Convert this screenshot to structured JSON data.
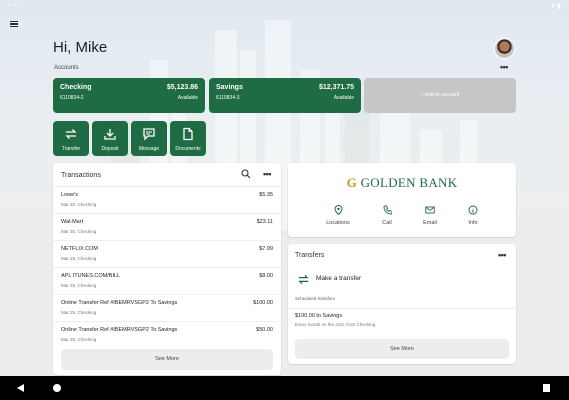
{
  "greeting": "Hi, Mike",
  "accounts_label": "Accounts",
  "accounts": [
    {
      "name": "Checking",
      "balance": "$5,123.86",
      "number": "6110834-2",
      "available": "Available"
    },
    {
      "name": "Savings",
      "balance": "$12,371.75",
      "number": "6110834-3",
      "available": "Available"
    }
  ],
  "add_account": "+ Add an account",
  "actions": [
    "Transfer",
    "Deposit",
    "Message",
    "Documents"
  ],
  "transactions": {
    "title": "Transactions",
    "rows": [
      {
        "desc": "Lowe's",
        "sub": "Mar 30, Checking",
        "amount": "$5.35"
      },
      {
        "desc": "Wal-Mart",
        "sub": "Mar 30, Checking",
        "amount": "$23.11"
      },
      {
        "desc": "NETFLIX.COM",
        "sub": "Mar 29, Checking",
        "amount": "$7.99"
      },
      {
        "desc": "APL ITUNES.COM/BILL",
        "sub": "Mar 29, Checking",
        "amount": "$8.00"
      },
      {
        "desc": "Online Transfer Ref #IBEMRVSGP2 To Savings",
        "sub": "Mar 29, Checking",
        "amount": "$100.00"
      },
      {
        "desc": "Online Transfer Ref #IBEMRVSGP2 To Savings",
        "sub": "Mar 26, Checking",
        "amount": "$50.00"
      }
    ],
    "see_more": "See More"
  },
  "bank": {
    "logo_initial": "G",
    "logo_text": "GOLDEN BANK",
    "links": [
      "Locations",
      "Call",
      "Email",
      "Info"
    ]
  },
  "transfers": {
    "title": "Transfers",
    "make": "Make a transfer",
    "scheduled_label": "Scheduled transfers",
    "item_title": "$100.00 to Savings",
    "item_sub": "Every month on the 21st, from Checking",
    "see_more": "See More"
  },
  "colors": {
    "brand_green": "#1e6b44",
    "gold": "#c99a1c"
  }
}
